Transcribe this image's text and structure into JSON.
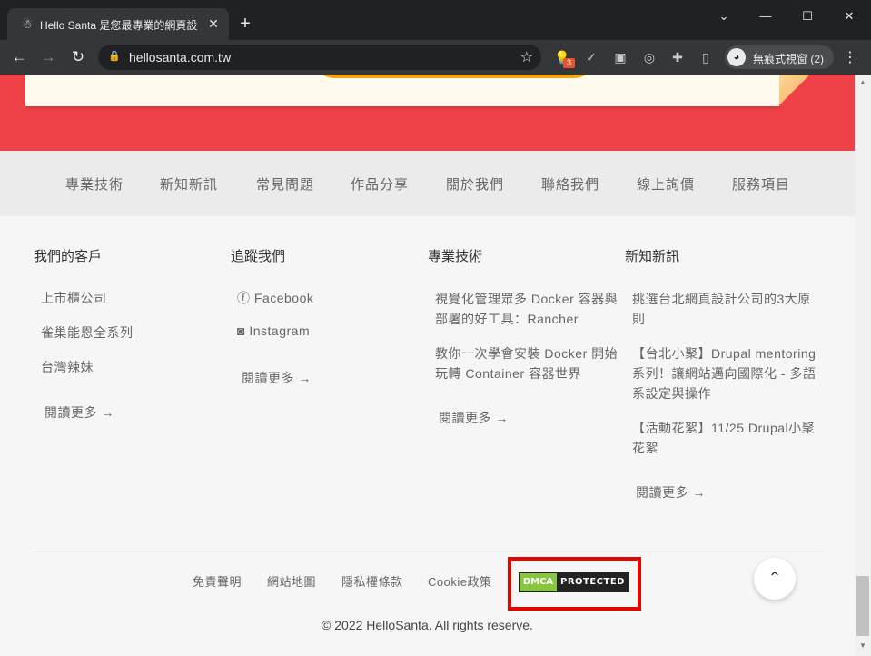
{
  "browser": {
    "tab_title": "Hello Santa 是您最專業的網頁設",
    "tab_favicon": "santa-icon",
    "url": "hellosanta.com.tw",
    "extension_badge": "3",
    "profile_label": "無痕式視窗 (2)"
  },
  "nav": {
    "items": [
      "專業技術",
      "新知新訊",
      "常見問題",
      "作品分享",
      "關於我們",
      "聯絡我們",
      "線上詢價",
      "服務項目"
    ]
  },
  "footer": {
    "clients": {
      "title": "我們的客戶",
      "items": [
        "上市櫃公司",
        "雀巢能恩全系列",
        "台灣辣妹"
      ],
      "read_more": "閱讀更多"
    },
    "follow": {
      "title": "追蹤我們",
      "items": [
        "Facebook",
        "Instagram"
      ],
      "read_more": "閱讀更多"
    },
    "tech": {
      "title": "專業技術",
      "items": [
        "視覺化管理眾多 Docker 容器與部署的好工具：Rancher",
        "教你一次學會安裝 Docker 開始玩轉 Container 容器世界"
      ],
      "read_more": "閱讀更多"
    },
    "news": {
      "title": "新知新訊",
      "items": [
        "挑選台北網頁設計公司的3大原則",
        "【台北小聚】Drupal mentoring 系列！讓網站邁向國際化 - 多語系設定與操作",
        "【活動花絮】11/25 Drupal小聚花絮"
      ],
      "read_more": "閱讀更多"
    },
    "bottom_links": [
      "免責聲明",
      "網站地圖",
      "隱私權條款",
      "Cookie政策"
    ],
    "dmca_left": "DMCA",
    "dmca_right": "PROTECTED",
    "copyright": "© 2022 HelloSanta. All rights reserve."
  }
}
